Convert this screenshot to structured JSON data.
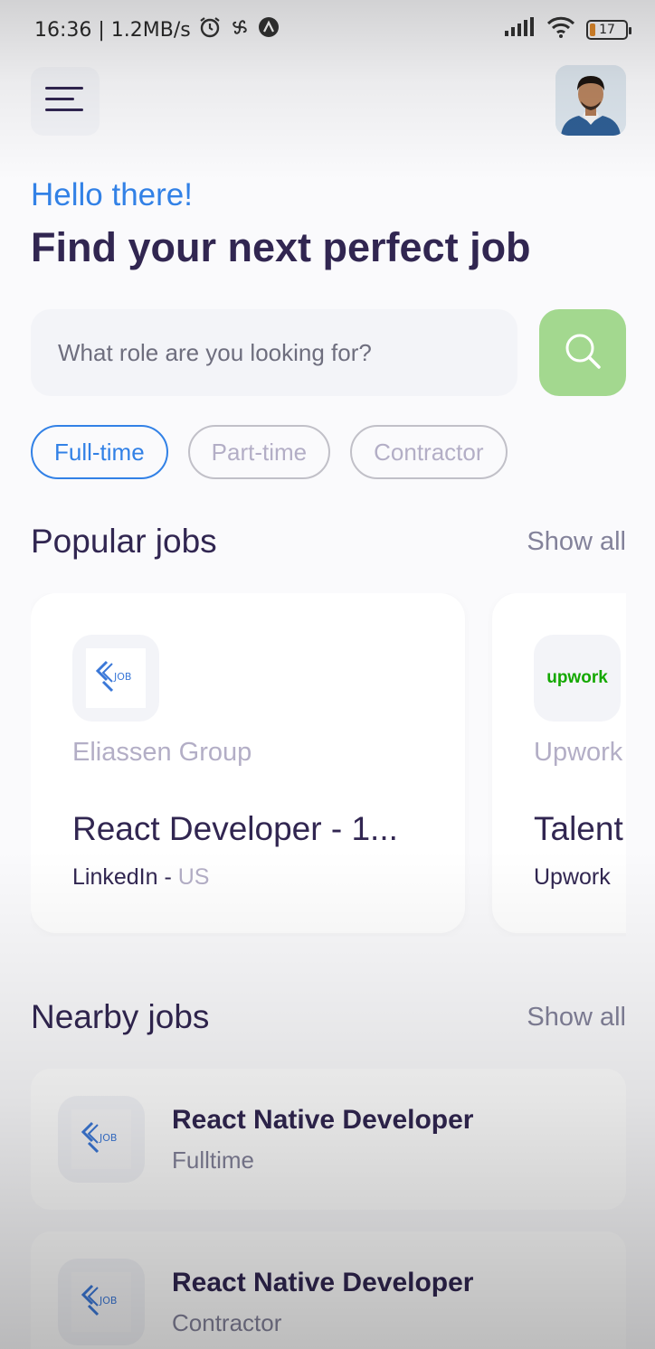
{
  "status_bar": {
    "time_speed": "16:36 | 1.2MB/s",
    "battery": "17"
  },
  "greeting": "Hello there!",
  "headline": "Find your next perfect job",
  "search": {
    "placeholder": "What role are you looking for?"
  },
  "job_types": [
    {
      "label": "Full-time",
      "active": true
    },
    {
      "label": "Part-time",
      "active": false
    },
    {
      "label": "Contractor",
      "active": false
    }
  ],
  "popular": {
    "title": "Popular jobs",
    "show_all": "Show all",
    "cards": [
      {
        "logo_text": "JOB",
        "company": "Eliassen Group",
        "title": "React Developer - 1...",
        "publisher": "LinkedIn",
        "sep": " - ",
        "country": "US"
      },
      {
        "logo_text": "upwork",
        "company": "Upwork",
        "title": "Talent",
        "publisher": "Upwork"
      }
    ]
  },
  "nearby": {
    "title": "Nearby jobs",
    "show_all": "Show all",
    "items": [
      {
        "logo_text": "JOB",
        "title": "React Native Developer",
        "type": "Fulltime"
      },
      {
        "logo_text": "JOB",
        "title": "React Native Developer",
        "type": "Contractor"
      }
    ]
  },
  "colors": {
    "primary": "#312651",
    "tertiary": "#3281E6",
    "gray": "#83829A",
    "gray2": "#B3AEC6",
    "search_btn": "#A3D88F",
    "upwork_green": "#14A800"
  },
  "icons": [
    "alarm-icon",
    "fan-icon",
    "notification-icon",
    "signal-icon",
    "wifi-icon",
    "battery-icon",
    "menu-icon",
    "search-icon",
    "job-logo-icon",
    "upwork-logo"
  ]
}
